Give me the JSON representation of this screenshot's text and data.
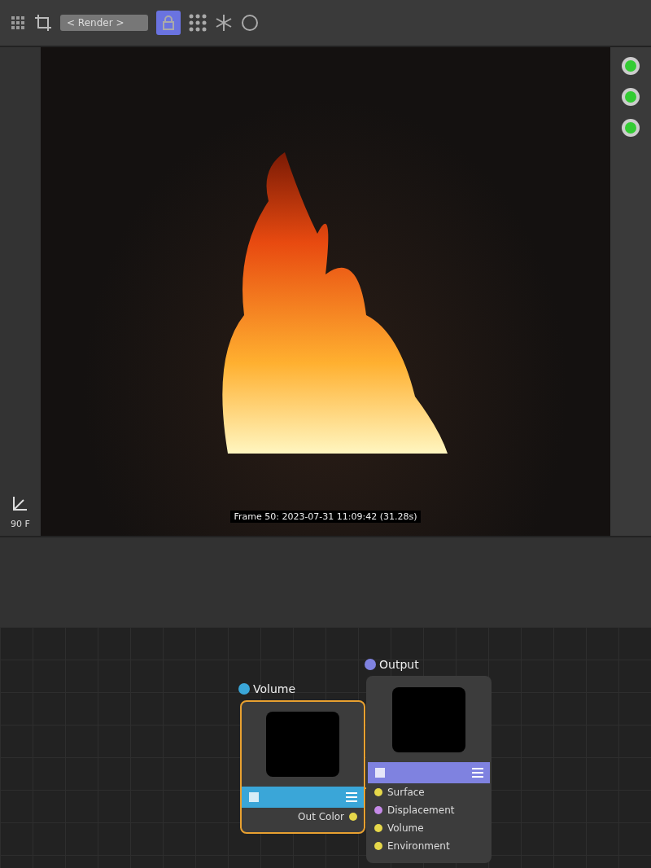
{
  "toolbar": {
    "render_dropdown": "< Render >",
    "lock_selected": true
  },
  "viewport": {
    "status": "Frame 50: 2023-07-31 11:09:42 (31.28s)"
  },
  "timeline": {
    "end_frame": "90 F"
  },
  "nodes": [
    {
      "title": "Volume",
      "selected": true,
      "color": "#3aa6d8",
      "outputs": [
        "Out Color"
      ]
    },
    {
      "title": "Output",
      "selected": false,
      "color": "#7f82e0",
      "inputs": [
        {
          "label": "Surface",
          "color": "#e6d84a"
        },
        {
          "label": "Displacement",
          "color": "#c58ae8"
        },
        {
          "label": "Volume",
          "color": "#e6d84a"
        },
        {
          "label": "Environment",
          "color": "#e6d84a"
        }
      ]
    }
  ]
}
